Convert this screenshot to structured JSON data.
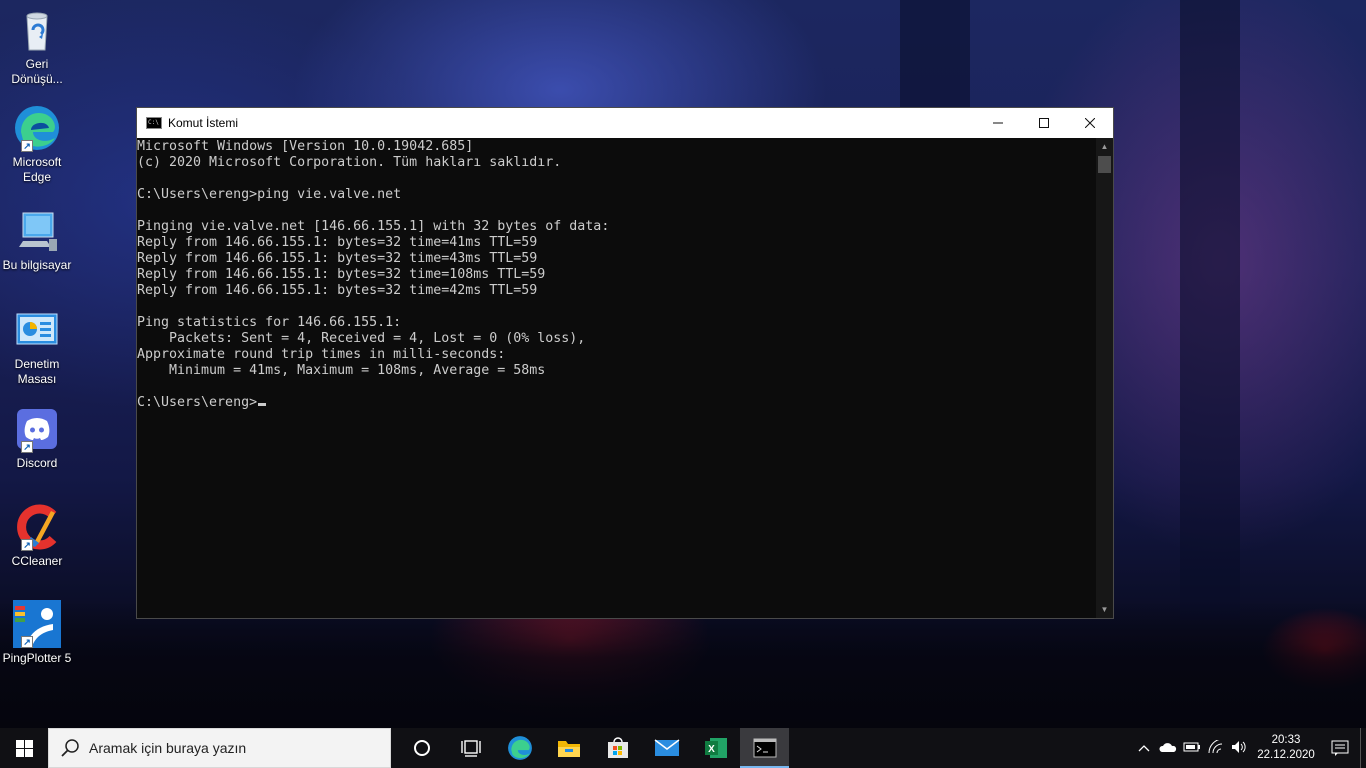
{
  "desktop": {
    "icons": [
      {
        "label": "Geri\nDönüşü...",
        "icon": "recycle-bin-icon"
      },
      {
        "label": "Microsoft\nEdge",
        "icon": "edge-icon"
      },
      {
        "label": "Bu bilgisayar",
        "icon": "computer-icon"
      },
      {
        "label": "Denetim\nMasası",
        "icon": "control-panel-icon"
      },
      {
        "label": "Discord",
        "icon": "discord-icon"
      },
      {
        "label": "CCleaner",
        "icon": "ccleaner-icon"
      },
      {
        "label": "PingPlotter 5",
        "icon": "pingplotter-icon"
      }
    ]
  },
  "window": {
    "title": "Komut İstemi",
    "minimize": "—",
    "maximize": "☐",
    "close": "✕",
    "console_lines": [
      "Microsoft Windows [Version 10.0.19042.685]",
      "(c) 2020 Microsoft Corporation. Tüm hakları saklıdır.",
      "",
      "C:\\Users\\ereng>ping vie.valve.net",
      "",
      "Pinging vie.valve.net [146.66.155.1] with 32 bytes of data:",
      "Reply from 146.66.155.1: bytes=32 time=41ms TTL=59",
      "Reply from 146.66.155.1: bytes=32 time=43ms TTL=59",
      "Reply from 146.66.155.1: bytes=32 time=108ms TTL=59",
      "Reply from 146.66.155.1: bytes=32 time=42ms TTL=59",
      "",
      "Ping statistics for 146.66.155.1:",
      "    Packets: Sent = 4, Received = 4, Lost = 0 (0% loss),",
      "Approximate round trip times in milli-seconds:",
      "    Minimum = 41ms, Maximum = 108ms, Average = 58ms",
      ""
    ],
    "prompt": "C:\\Users\\ereng>"
  },
  "taskbar": {
    "search_placeholder": "Aramak için buraya yazın",
    "pinned": [
      "cortana-icon",
      "task-view-icon",
      "edge-icon",
      "file-explorer-icon",
      "store-icon",
      "mail-icon",
      "excel-icon",
      "cmd-icon"
    ],
    "active_app": "cmd-icon",
    "clock_time": "20:33",
    "clock_date": "22.12.2020"
  },
  "colors": {
    "accent": "#77b7f0",
    "console_bg": "#0c0c0c",
    "console_text": "#cccccc"
  }
}
